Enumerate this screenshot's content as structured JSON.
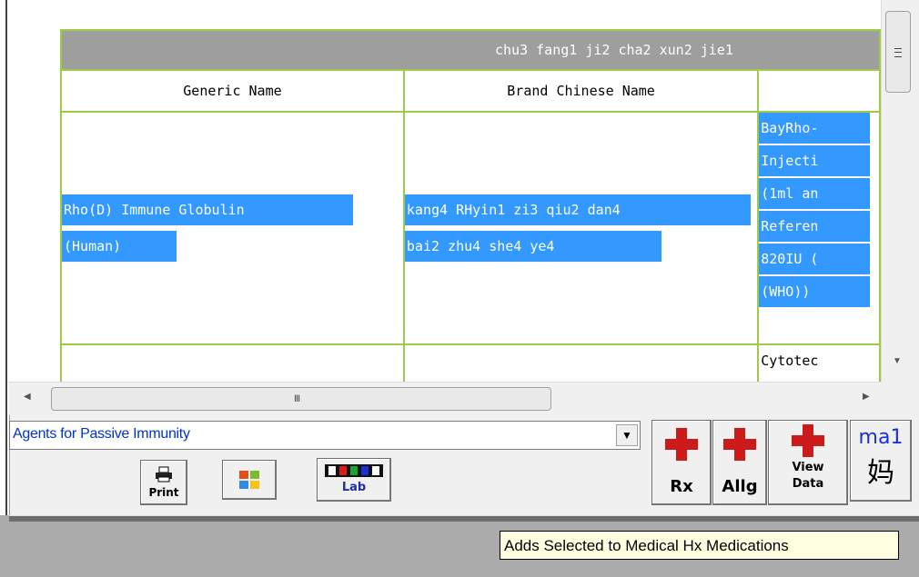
{
  "table": {
    "title": "chu3 fang1 ji2 cha2 xun2 jie1",
    "columns": [
      "Generic Name",
      "Brand Chinese Name"
    ],
    "rows": [
      {
        "generic": [
          "Rho(D) Immune Globulin",
          "(Human)"
        ],
        "brand": [
          "kang4 RHyin1 zi3 qiu2 dan4",
          "bai2 zhu4 she4 ye4"
        ],
        "col3": [
          "BayRho-",
          "Injecti",
          "(1ml an",
          "Referen",
          "820IU (",
          "(WHO))"
        ]
      },
      {
        "generic": [],
        "brand": [],
        "col3": [
          "Cytotec"
        ]
      }
    ]
  },
  "scrollbars": {
    "hgrip": "III"
  },
  "category_combo": {
    "value": "Agents for Passive Immunity"
  },
  "toolbar": {
    "print_label": "Print",
    "lab_label": "Lab",
    "rx_label": "Rx",
    "allg_label": "Allg",
    "view_label_1": "View",
    "view_label_2": "Data",
    "ime_label": "ma1",
    "ime_char": "妈"
  },
  "tooltip": {
    "text": "Adds Selected to Medical Hx Medications"
  },
  "colors": {
    "selection": "#3399ff",
    "grid_border": "#9ccb45",
    "cross_red": "#cc1a1a",
    "combo_text": "#0033cc"
  }
}
